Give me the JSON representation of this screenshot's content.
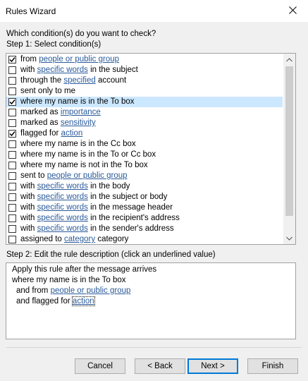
{
  "window": {
    "title": "Rules Wizard",
    "close_icon": "close-icon"
  },
  "prompt": "Which condition(s) do you want to check?",
  "step1_label": "Step 1: Select condition(s)",
  "conditions": [
    {
      "checked": true,
      "selected": false,
      "parts": [
        {
          "t": "from "
        },
        {
          "t": "people or public group",
          "link": true
        }
      ]
    },
    {
      "checked": false,
      "selected": false,
      "parts": [
        {
          "t": "with "
        },
        {
          "t": "specific words",
          "link": true
        },
        {
          "t": " in the subject"
        }
      ]
    },
    {
      "checked": false,
      "selected": false,
      "parts": [
        {
          "t": "through the "
        },
        {
          "t": "specified",
          "link": true
        },
        {
          "t": " account"
        }
      ]
    },
    {
      "checked": false,
      "selected": false,
      "parts": [
        {
          "t": "sent only to me"
        }
      ]
    },
    {
      "checked": true,
      "selected": true,
      "parts": [
        {
          "t": "where my name is in the To box"
        }
      ]
    },
    {
      "checked": false,
      "selected": false,
      "parts": [
        {
          "t": "marked as "
        },
        {
          "t": "importance",
          "link": true
        }
      ]
    },
    {
      "checked": false,
      "selected": false,
      "parts": [
        {
          "t": "marked as "
        },
        {
          "t": "sensitivity",
          "link": true
        }
      ]
    },
    {
      "checked": true,
      "selected": false,
      "parts": [
        {
          "t": "flagged for "
        },
        {
          "t": "action",
          "link": true
        }
      ]
    },
    {
      "checked": false,
      "selected": false,
      "parts": [
        {
          "t": "where my name is in the Cc box"
        }
      ]
    },
    {
      "checked": false,
      "selected": false,
      "parts": [
        {
          "t": "where my name is in the To or Cc box"
        }
      ]
    },
    {
      "checked": false,
      "selected": false,
      "parts": [
        {
          "t": "where my name is not in the To box"
        }
      ]
    },
    {
      "checked": false,
      "selected": false,
      "parts": [
        {
          "t": "sent to "
        },
        {
          "t": "people or public group",
          "link": true
        }
      ]
    },
    {
      "checked": false,
      "selected": false,
      "parts": [
        {
          "t": "with "
        },
        {
          "t": "specific words",
          "link": true
        },
        {
          "t": " in the body"
        }
      ]
    },
    {
      "checked": false,
      "selected": false,
      "parts": [
        {
          "t": "with "
        },
        {
          "t": "specific words",
          "link": true
        },
        {
          "t": " in the subject or body"
        }
      ]
    },
    {
      "checked": false,
      "selected": false,
      "parts": [
        {
          "t": "with "
        },
        {
          "t": "specific words",
          "link": true
        },
        {
          "t": " in the message header"
        }
      ]
    },
    {
      "checked": false,
      "selected": false,
      "parts": [
        {
          "t": "with "
        },
        {
          "t": "specific words",
          "link": true
        },
        {
          "t": " in the recipient's address"
        }
      ]
    },
    {
      "checked": false,
      "selected": false,
      "parts": [
        {
          "t": "with "
        },
        {
          "t": "specific words",
          "link": true
        },
        {
          "t": " in the sender's address"
        }
      ]
    },
    {
      "checked": false,
      "selected": false,
      "parts": [
        {
          "t": "assigned to "
        },
        {
          "t": "category",
          "link": true
        },
        {
          "t": " category"
        }
      ]
    }
  ],
  "step2_label": "Step 2: Edit the rule description (click an underlined value)",
  "description": {
    "line1": "Apply this rule after the message arrives",
    "line2": "where my name is in the To box",
    "line3_prefix": "and from ",
    "line3_link": "people or public group",
    "line4_prefix": "and flagged for ",
    "line4_link": "action"
  },
  "buttons": {
    "cancel": "Cancel",
    "back": "< Back",
    "next": "Next >",
    "finish": "Finish"
  },
  "colors": {
    "link": "#2a5a9a",
    "selection": "#cce8ff",
    "default_button_border": "#0078d7"
  }
}
